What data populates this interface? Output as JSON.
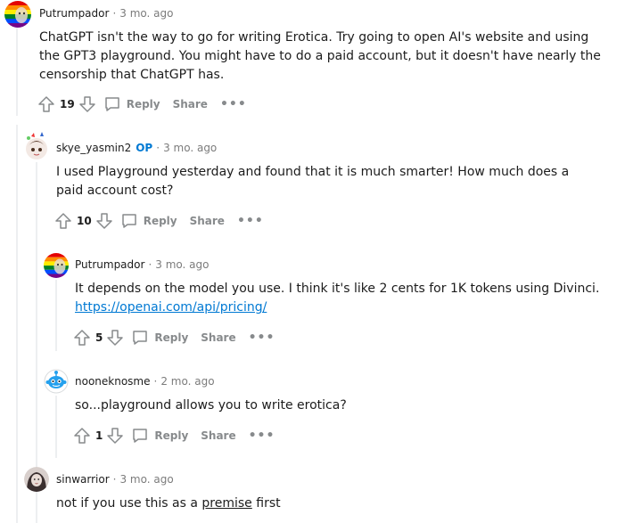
{
  "comments": [
    {
      "author": "Putrumpador",
      "op": "",
      "time": "3 mo. ago",
      "body": "ChatGPT isn't the way to go for writing Erotica. Try going to open AI's website and using the GPT3 playground. You might have to do a paid account, but it doesn't have nearly the censorship that ChatGPT has.",
      "votes": "19",
      "avatar": "rainbow-avatar"
    },
    {
      "author": "skye_yasmin2",
      "op": "OP",
      "time": "3 mo. ago",
      "body": "I used Playground yesterday and found that it is much smarter! How much does a paid account cost?",
      "votes": "10",
      "avatar": "anime-avatar"
    },
    {
      "author": "Putrumpador",
      "op": "",
      "time": "3 mo. ago",
      "body": "It depends on the model you use. I think it's like 2 cents for 1K tokens using Divinci.",
      "link": "https://openai.com/api/pricing/",
      "votes": "5",
      "avatar": "rainbow-avatar"
    },
    {
      "author": "nooneknosme",
      "op": "",
      "time": "2 mo. ago",
      "body": "so...playground allows you to write erotica?",
      "votes": "1",
      "avatar": "snoo-avatar"
    },
    {
      "author": "sinwarrior",
      "op": "",
      "time": "3 mo. ago",
      "body_pre": "not if you use this as a ",
      "body_link": "premise",
      "body_post": " first",
      "avatar": "photo-avatar"
    }
  ],
  "labels": {
    "reply": "Reply",
    "share": "Share",
    "more": "•••"
  },
  "colors": {
    "meta_gray": "#7c7c7c",
    "action_gray": "#878a8c",
    "op_blue": "#0079d3",
    "thread_line": "#edeff1"
  }
}
